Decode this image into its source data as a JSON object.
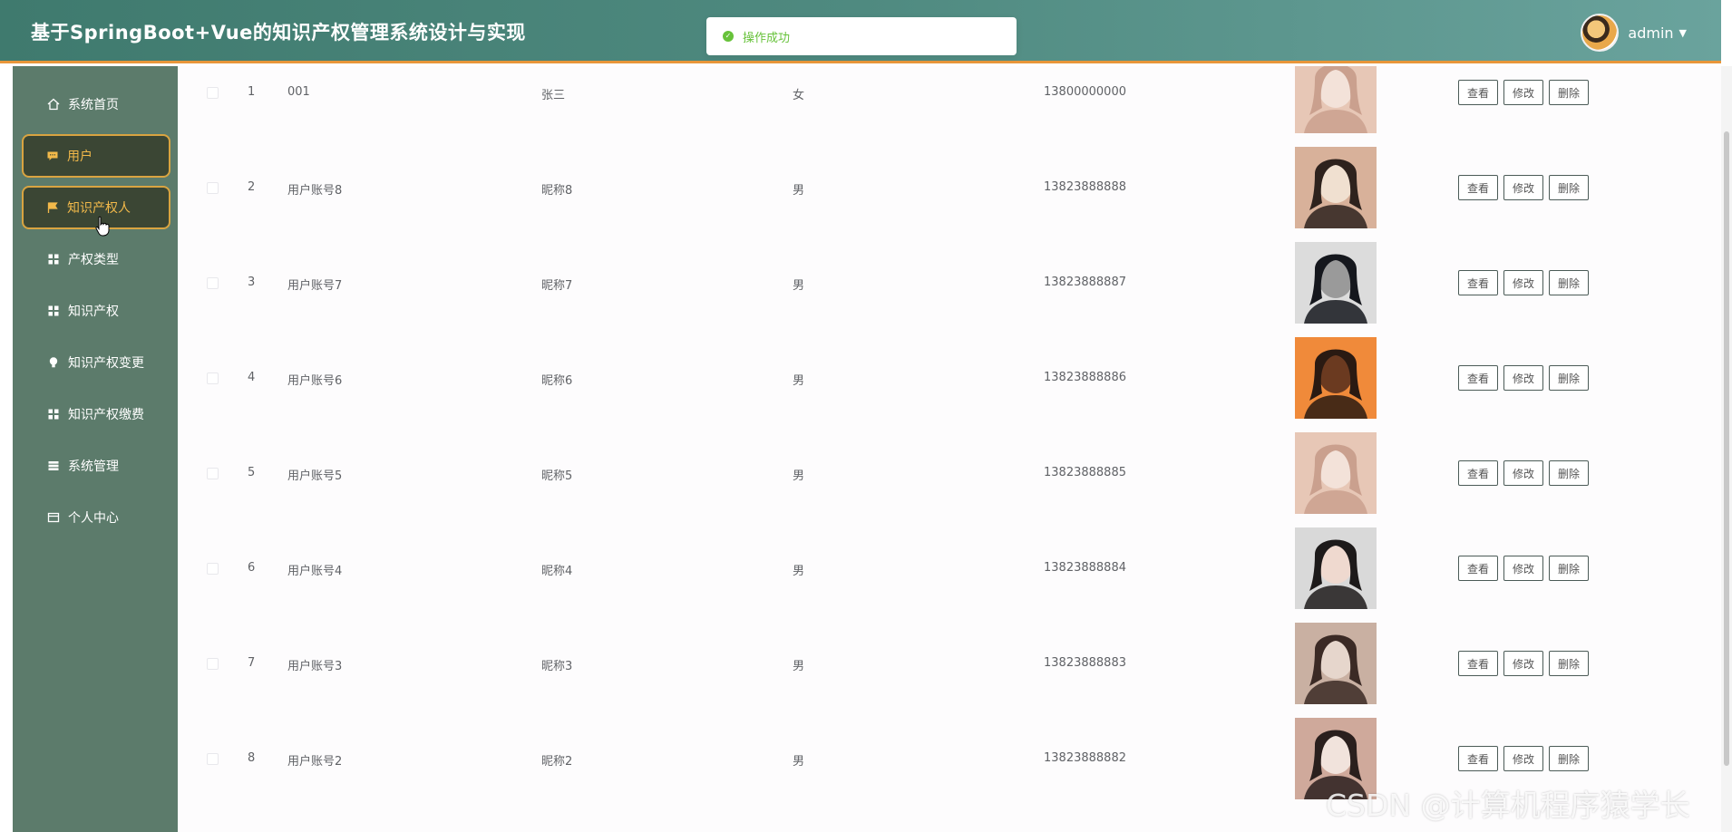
{
  "app": {
    "title": "基于SpringBoot+Vue的知识产权管理系统设计与实现",
    "user": "admin"
  },
  "toast": {
    "text": "操作成功",
    "type": "success"
  },
  "sidebar": {
    "items": [
      {
        "label": "系统首页",
        "icon": "home-icon",
        "active": false
      },
      {
        "label": "用户",
        "icon": "chat-icon",
        "active": true
      },
      {
        "label": "知识产权人",
        "icon": "flag-icon",
        "active": true
      },
      {
        "label": "产权类型",
        "icon": "grid-icon",
        "active": false
      },
      {
        "label": "知识产权",
        "icon": "grid-icon",
        "active": false
      },
      {
        "label": "知识产权变更",
        "icon": "bulb-icon",
        "active": false
      },
      {
        "label": "知识产权缴费",
        "icon": "grid-icon",
        "active": false
      },
      {
        "label": "系统管理",
        "icon": "list-icon",
        "active": false
      },
      {
        "label": "个人中心",
        "icon": "card-icon",
        "active": false
      }
    ]
  },
  "table": {
    "actions": {
      "view": "查看",
      "edit": "修改",
      "delete": "删除"
    },
    "rows": [
      {
        "index": "1",
        "account": "001",
        "nickname": "张三",
        "gender": "女",
        "phone": "13800000000",
        "photo": "portrait-1"
      },
      {
        "index": "2",
        "account": "用户账号8",
        "nickname": "昵称8",
        "gender": "男",
        "phone": "13823888888",
        "photo": "portrait-2"
      },
      {
        "index": "3",
        "account": "用户账号7",
        "nickname": "昵称7",
        "gender": "男",
        "phone": "13823888887",
        "photo": "portrait-3"
      },
      {
        "index": "4",
        "account": "用户账号6",
        "nickname": "昵称6",
        "gender": "男",
        "phone": "13823888886",
        "photo": "portrait-4"
      },
      {
        "index": "5",
        "account": "用户账号5",
        "nickname": "昵称5",
        "gender": "男",
        "phone": "13823888885",
        "photo": "portrait-5"
      },
      {
        "index": "6",
        "account": "用户账号4",
        "nickname": "昵称4",
        "gender": "男",
        "phone": "13823888884",
        "photo": "portrait-6"
      },
      {
        "index": "7",
        "account": "用户账号3",
        "nickname": "昵称3",
        "gender": "男",
        "phone": "13823888883",
        "photo": "portrait-7"
      },
      {
        "index": "8",
        "account": "用户账号2",
        "nickname": "昵称2",
        "gender": "男",
        "phone": "13823888882",
        "photo": "portrait-8"
      }
    ]
  },
  "watermark": "CSDN @计算机程序猿学长",
  "colors": {
    "header_start": "#3f7a6e",
    "header_end": "#6aa39d",
    "header_border": "#e8963a",
    "sidebar_bg": "#5c7b6b",
    "active_bg": "#3b4634",
    "active_border": "#d9a441",
    "active_text": "#f2b94a",
    "success": "#67c23a"
  }
}
